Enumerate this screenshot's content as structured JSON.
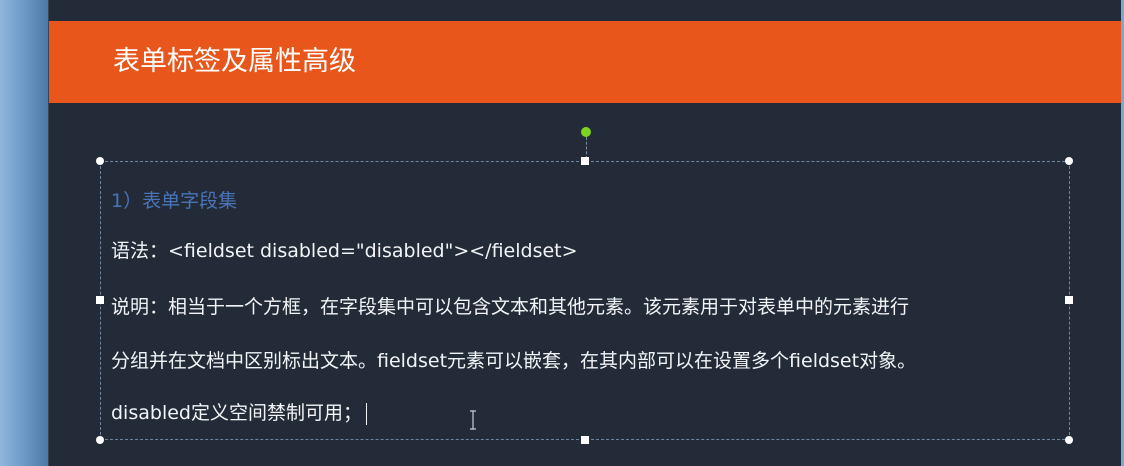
{
  "slide": {
    "title": "表单标签及属性高级"
  },
  "textbox": {
    "heading": "1）表单字段集",
    "syntax": "语法：<fieldset disabled=\"disabled\"></fieldset>",
    "desc_line1": "说明：相当于一个方框，在字段集中可以包含文本和其他元素。该元素用于对表单中的元素进行",
    "desc_line2": "分组并在文档中区别标出文本。fieldset元素可以嵌套，在其内部可以在设置多个fieldset对象。",
    "desc_line3": "disabled定义空间禁制可用；"
  },
  "colors": {
    "title_bar": "#e8561b",
    "background": "#222b37",
    "heading_text": "#4a74b8",
    "body_text": "#f2f4f7",
    "rotate_handle": "#7ed321"
  },
  "icons": {
    "cursor": "text-ibeam-cursor-icon",
    "rotate": "rotate-handle-icon"
  }
}
